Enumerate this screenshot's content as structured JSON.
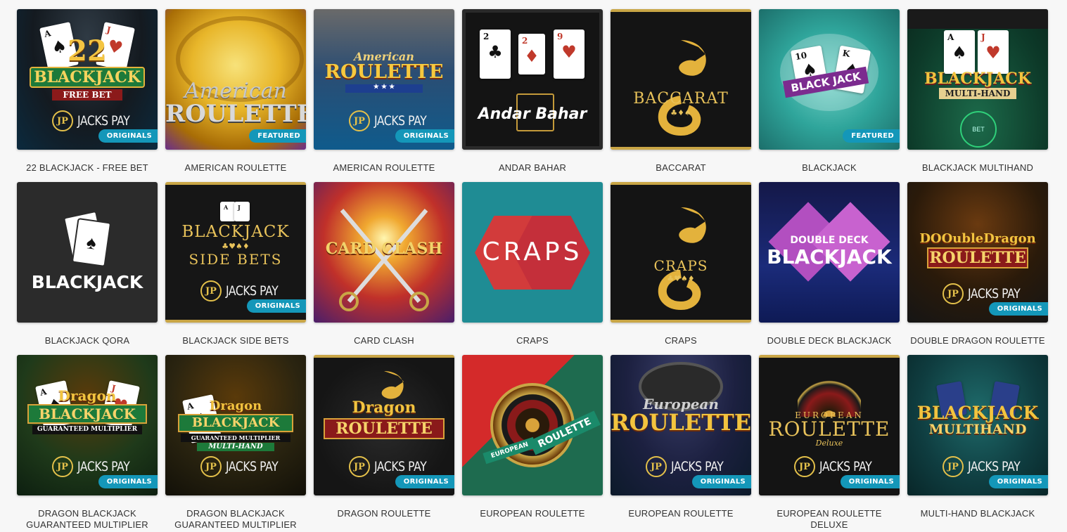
{
  "games": [
    {
      "title": "22 BLACKJACK - FREE BET",
      "badge": "ORIGINALS",
      "art": {
        "line1": "22",
        "line2": "BLACKJACK",
        "line3": "FREE BET",
        "brand": "JACKS PAY"
      }
    },
    {
      "title": "AMERICAN ROULETTE",
      "badge": "FEATURED",
      "art": {
        "line1": "American",
        "line2": "ROULETTE"
      }
    },
    {
      "title": "AMERICAN ROULETTE",
      "badge": "ORIGINALS",
      "art": {
        "line1": "American",
        "line2": "ROULETTE",
        "brand": "JACKS PAY"
      }
    },
    {
      "title": "ANDAR BAHAR",
      "badge": "",
      "art": {
        "line1": "Andar Bahar"
      }
    },
    {
      "title": "BACCARAT",
      "badge": "",
      "art": {
        "line1": "BACCARAT"
      }
    },
    {
      "title": "BLACKJACK",
      "badge": "FEATURED",
      "art": {
        "line1": "BLACK JACK"
      }
    },
    {
      "title": "BLACKJACK MULTIHAND",
      "badge": "",
      "art": {
        "line1": "BLACKJACK",
        "line2": "MULTI-HAND",
        "line3": "BET"
      }
    },
    {
      "title": "BLACKJACK QORA",
      "badge": "",
      "art": {
        "line1": "BLACKJACK"
      }
    },
    {
      "title": "BLACKJACK SIDE BETS",
      "badge": "ORIGINALS",
      "art": {
        "line1": "BLACKJACK",
        "line2": "SIDE BETS",
        "brand": "JACKS PAY"
      }
    },
    {
      "title": "CARD CLASH",
      "badge": "",
      "art": {
        "line1": "CARD CLASH"
      }
    },
    {
      "title": "CRAPS",
      "badge": "",
      "art": {
        "line1": "CRAPS"
      }
    },
    {
      "title": "CRAPS",
      "badge": "",
      "art": {
        "line1": "CRAPS"
      }
    },
    {
      "title": "DOUBLE DECK BLACKJACK",
      "badge": "",
      "art": {
        "line1": "DOUBLE DECK",
        "line2": "BLACKJACK"
      }
    },
    {
      "title": "DOUBLE DRAGON ROULETTE",
      "badge": "ORIGINALS",
      "art": {
        "line1": "DOOubleDragon",
        "line2": "ROULETTE",
        "brand": "JACKS PAY"
      }
    },
    {
      "title": "DRAGON BLACKJACK GUARANTEED MULTIPLIER",
      "badge": "ORIGINALS",
      "art": {
        "line1": "Dragon",
        "line2": "BLACKJACK",
        "line3": "GUARANTEED MULTIPLIER",
        "brand": "JACKS PAY"
      }
    },
    {
      "title": "DRAGON BLACKJACK GUARANTEED MULTIPLIER",
      "badge": "",
      "art": {
        "line1": "Dragon",
        "line2": "BLACKJACK",
        "line3": "GUARANTEED MULTIPLIER",
        "line4": "MULTI-HAND",
        "brand": "JACKS PAY"
      }
    },
    {
      "title": "DRAGON ROULETTE",
      "badge": "ORIGINALS",
      "art": {
        "line1": "Dragon",
        "line2": "ROULETTE",
        "brand": "JACKS PAY"
      }
    },
    {
      "title": "EUROPEAN ROULETTE",
      "badge": "",
      "art": {
        "line1": "EUROPEAN",
        "line2": "ROULETTE"
      }
    },
    {
      "title": "EUROPEAN ROULETTE",
      "badge": "ORIGINALS",
      "art": {
        "line1": "European",
        "line2": "ROULETTE",
        "brand": "JACKS PAY"
      }
    },
    {
      "title": "EUROPEAN ROULETTE DELUXE",
      "badge": "ORIGINALS",
      "art": {
        "line1": "EUROPEAN",
        "line2": "ROULETTE",
        "line3": "Deluxe",
        "brand": "JACKS PAY"
      }
    },
    {
      "title": "MULTI-HAND BLACKJACK",
      "badge": "ORIGINALS",
      "art": {
        "line1": "BLACKJACK",
        "line2": "MULTIHAND",
        "brand": "JACKS PAY"
      }
    }
  ]
}
